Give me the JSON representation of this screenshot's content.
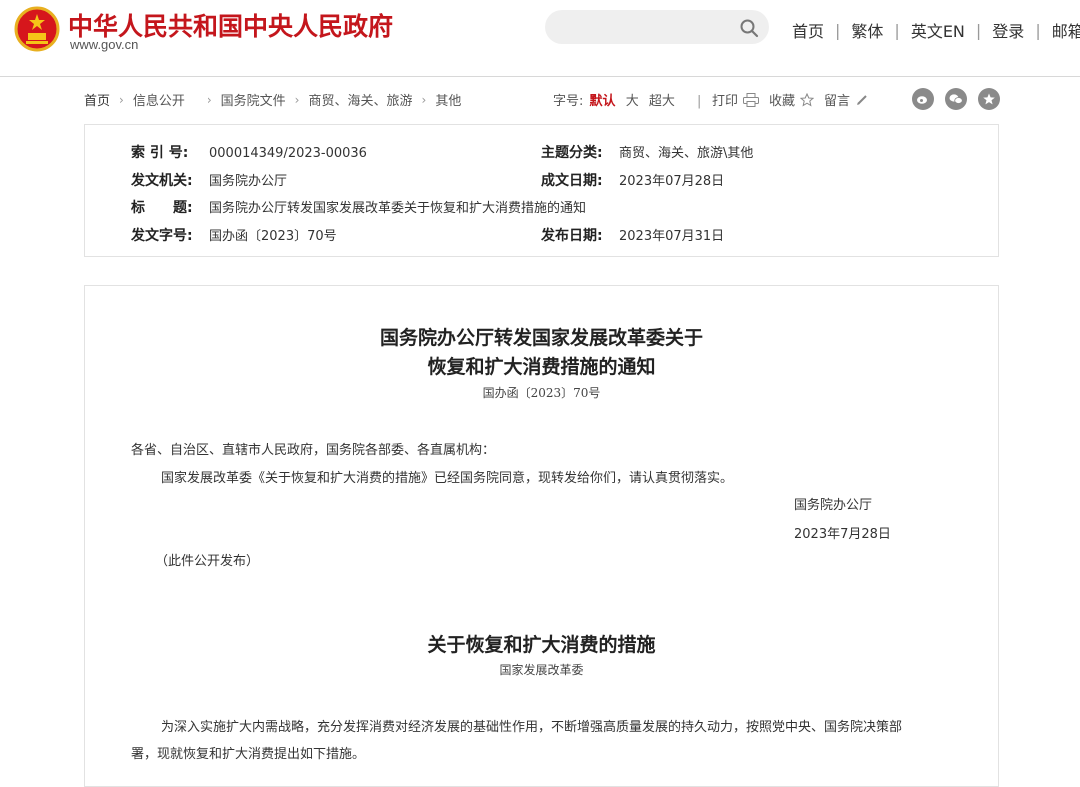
{
  "header": {
    "site_title": "中华人民共和国中央人民政府",
    "site_domain": "www.gov.cn",
    "search_placeholder": "",
    "nav": [
      "首页",
      "繁体",
      "英文EN",
      "登录",
      "邮箱"
    ],
    "nav_separator": "|"
  },
  "breadcrumb": [
    "首页",
    "信息公开",
    "国务院文件",
    "商贸、海关、旅游",
    "其他"
  ],
  "font_size": {
    "label": "字号:",
    "options": [
      "默认",
      "大",
      "超大"
    ],
    "selected": "默认",
    "separator": "|"
  },
  "tools": [
    "打印",
    "收藏",
    "留言"
  ],
  "share_icons": [
    "weibo-icon",
    "wechat-icon",
    "qzone-icon"
  ],
  "meta": {
    "index_label": "索 引 号:",
    "index_value": "000014349/2023-00036",
    "topic_label": "主题分类:",
    "topic_value": "商贸、海关、旅游\\其他",
    "issuer_label": "发文机关:",
    "issuer_value": "国务院办公厅",
    "written_label": "成文日期:",
    "written_value": "2023年07月28日",
    "title_label": "标　　题:",
    "title_value": "国务院办公厅转发国家发展改革委关于恢复和扩大消费措施的通知",
    "docno_label": "发文字号:",
    "docno_value": "国办函〔2023〕70号",
    "published_label": "发布日期:",
    "published_value": "2023年07月31日"
  },
  "article": {
    "title_line1": "国务院办公厅转发国家发展改革委关于",
    "title_line2": "恢复和扩大消费措施的通知",
    "doc_number": "国办函〔2023〕70号",
    "salutation": "各省、自治区、直辖市人民政府，国务院各部委、各直属机构：",
    "body": "国家发展改革委《关于恢复和扩大消费的措施》已经国务院同意，现转发给你们，请认真贯彻落实。",
    "signature": "国务院办公厅",
    "date": "2023年7月28日",
    "note": "（此件公开发布）",
    "sub_title": "关于恢复和扩大消费的措施",
    "sub_org": "国家发展改革委",
    "para_line1": "为深入实施扩大内需战略，充分发挥消费对经济发展的基础性作用，不断增强高质量发展的持久动力，按照党中央、国务院决策部",
    "para_line2": "署，现就恢复和扩大消费提出如下措施。"
  },
  "colors": {
    "brand_red": "#c4161c",
    "border": "#e2e2e2",
    "search_bg": "#efefef"
  }
}
